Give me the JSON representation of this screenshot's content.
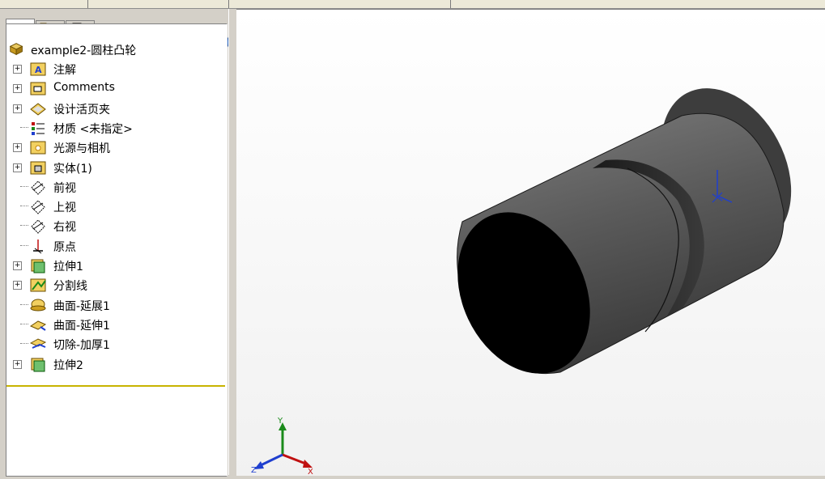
{
  "tree": {
    "root": "example2-圆柱凸轮",
    "items": [
      {
        "label": "注解",
        "icon": "annotations-folder-icon",
        "expandable": true
      },
      {
        "label": "Comments",
        "icon": "comments-folder-icon",
        "expandable": true
      },
      {
        "label": "设计活页夹",
        "icon": "design-binder-icon",
        "expandable": true
      },
      {
        "label": "材质 <未指定>",
        "icon": "material-icon",
        "expandable": false
      },
      {
        "label": "光源与相机",
        "icon": "lights-cameras-folder-icon",
        "expandable": true
      },
      {
        "label": "实体(1)",
        "icon": "solid-bodies-folder-icon",
        "expandable": true
      },
      {
        "label": "前视",
        "icon": "plane-icon",
        "expandable": false
      },
      {
        "label": "上视",
        "icon": "plane-icon",
        "expandable": false
      },
      {
        "label": "右视",
        "icon": "plane-icon",
        "expandable": false
      },
      {
        "label": "原点",
        "icon": "origin-icon",
        "expandable": false
      },
      {
        "label": "拉伸1",
        "icon": "extrude-feature-icon",
        "expandable": true
      },
      {
        "label": "分割线",
        "icon": "split-line-icon",
        "expandable": true
      },
      {
        "label": "曲面-延展1",
        "icon": "surface-radiate-icon",
        "expandable": false
      },
      {
        "label": "曲面-延伸1",
        "icon": "surface-extend-icon",
        "expandable": false
      },
      {
        "label": "切除-加厚1",
        "icon": "thicken-cut-icon",
        "expandable": false
      },
      {
        "label": "拉伸2",
        "icon": "extrude-feature-icon",
        "expandable": true
      }
    ]
  },
  "triad": {
    "y": "Y",
    "x": "X",
    "z": "Z"
  },
  "colors": {
    "accent": "#1f5fbf",
    "tree_end_line": "#c8b400",
    "model_face": "#6e6e6e",
    "model_end": "#000000"
  }
}
